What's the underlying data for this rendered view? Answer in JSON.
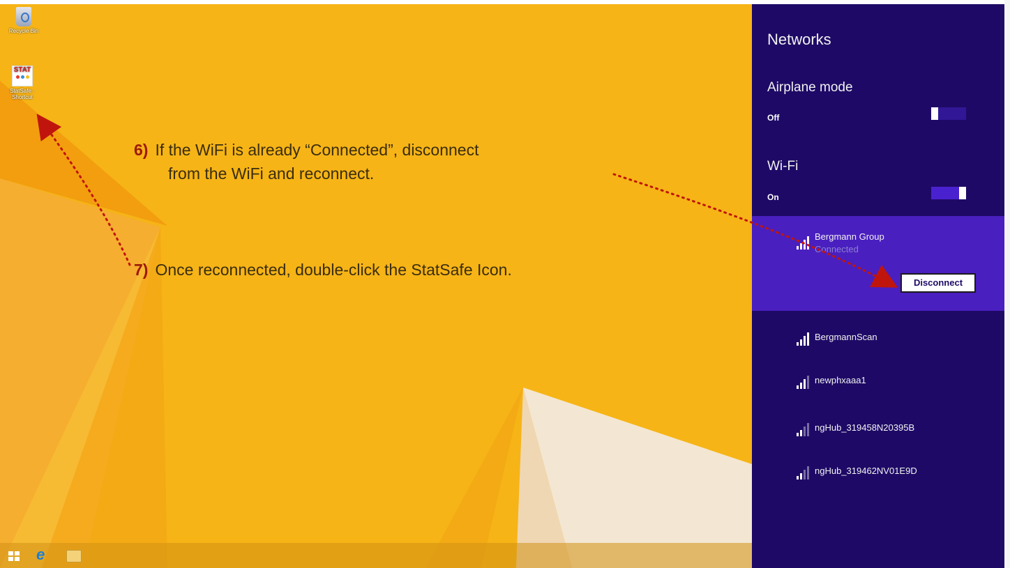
{
  "desktop": {
    "icons": [
      {
        "label": "Recycle Bin",
        "icon": "recycle-bin-icon"
      },
      {
        "label": "StatSafe - Shortcut",
        "icon": "statsafe-icon",
        "glyph_text": "STAT"
      }
    ],
    "taskbar": [
      {
        "name": "start-icon"
      },
      {
        "name": "internet-explorer-icon",
        "glyph": "e"
      },
      {
        "name": "file-explorer-icon"
      }
    ]
  },
  "instructions": [
    {
      "number": "6)",
      "line1": "If the WiFi is already “Connected”, disconnect",
      "line2": "from the WiFi and reconnect."
    },
    {
      "number": "7)",
      "line1": "Once reconnected, double-click the StatSafe Icon."
    }
  ],
  "networks_panel": {
    "title": "Networks",
    "airplane_mode": {
      "label": "Airplane mode",
      "state": "Off"
    },
    "wifi": {
      "label": "Wi-Fi",
      "state": "On"
    },
    "connected_network": {
      "name": "Bergmann Group",
      "status": "Connected",
      "action": "Disconnect"
    },
    "networks": [
      {
        "name": "BergmannScan"
      },
      {
        "name": "newphxaaa1"
      },
      {
        "name": "ngHub_319458N20395B"
      },
      {
        "name": "ngHub_319462NV01E9D"
      }
    ]
  },
  "colors": {
    "desktop_bg": "#f6b417",
    "panel_bg": "#1e0a66",
    "selected_bg": "#4a1fbf",
    "annotation": "#c0150c"
  }
}
